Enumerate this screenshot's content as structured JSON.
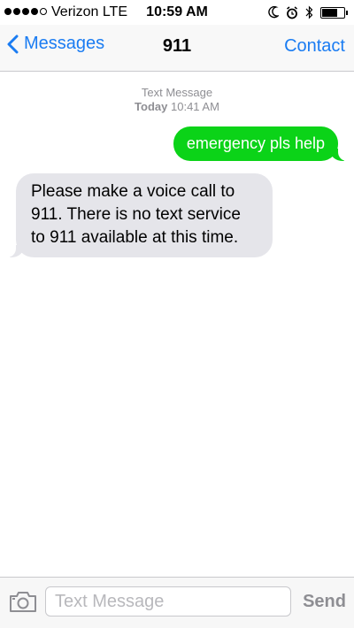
{
  "status_bar": {
    "carrier": "Verizon",
    "network": "LTE",
    "time": "10:59 AM",
    "signal_bars_filled": 4,
    "signal_bars_total": 5,
    "icons": [
      "moon-icon",
      "alarm-icon",
      "bluetooth-icon",
      "battery-icon"
    ],
    "battery_level": 0.76
  },
  "nav": {
    "back_label": "Messages",
    "title": "911",
    "contact_label": "Contact",
    "accent_color": "#1a7cf2"
  },
  "thread": {
    "meta_type": "Text Message",
    "meta_day": "Today",
    "meta_time": "10:41 AM",
    "messages": [
      {
        "direction": "sent",
        "text": "emergency pls help",
        "color": "#0bd318"
      },
      {
        "direction": "received",
        "text": "Please make a voice call to 911. There is no text service to 911 available at this time.",
        "color": "#e5e5ea"
      }
    ]
  },
  "input_bar": {
    "placeholder": "Text Message",
    "value": "",
    "send_label": "Send"
  }
}
